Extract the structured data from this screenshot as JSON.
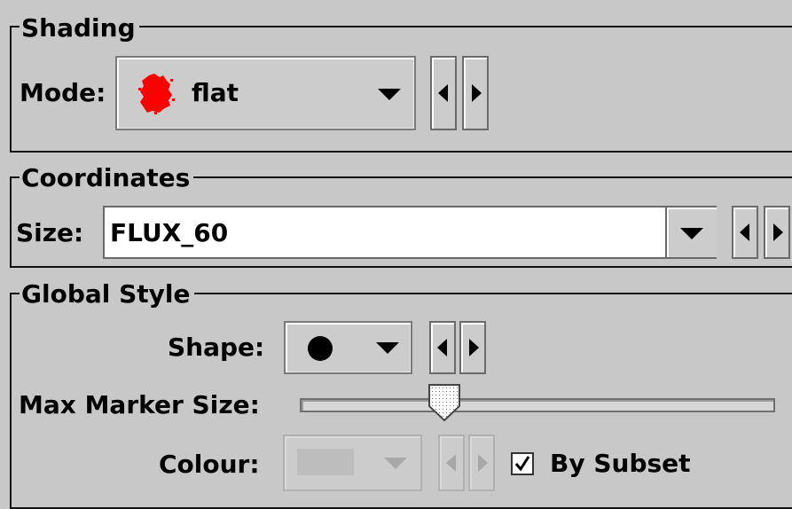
{
  "shading": {
    "title": "Shading",
    "mode_label": "Mode:",
    "mode_value": "flat",
    "mode_icon": "red-blob-icon",
    "accent_color": "#ff0000"
  },
  "coordinates": {
    "title": "Coordinates",
    "size_label": "Size:",
    "size_value": "FLUX_60"
  },
  "global_style": {
    "title": "Global Style",
    "shape_label": "Shape:",
    "shape_icon": "filled-circle-icon",
    "max_marker_label": "Max Marker Size:",
    "max_marker_level": 0.29,
    "colour_label": "Colour:",
    "colour_enabled": false,
    "by_subset_label": "By Subset",
    "by_subset_checked": true
  }
}
